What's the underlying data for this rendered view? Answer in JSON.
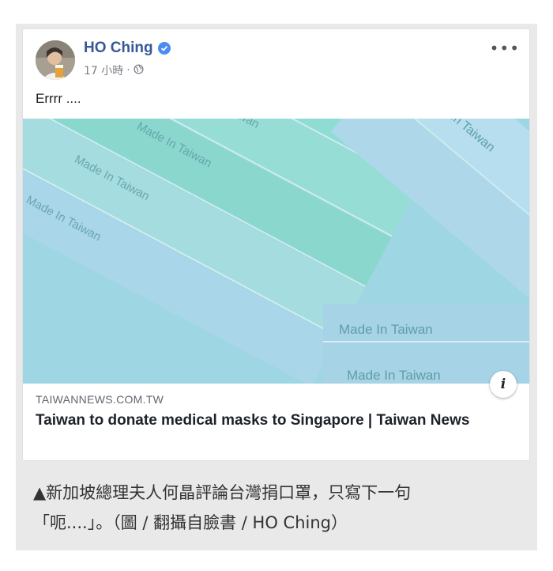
{
  "post": {
    "author": "HO Ching",
    "timestamp": "17 小時",
    "separator": "·",
    "text": "Errrr ...."
  },
  "link": {
    "domain": "TAIWANNEWS.COM.TW",
    "title": "Taiwan to donate medical masks to Singapore | Taiwan News",
    "image_imprint": "Made In Taiwan"
  },
  "caption": {
    "line1": "▲新加坡總理夫人何晶評論台灣捐口罩，只寫下一句",
    "line2": "「呃....」。（圖 / 翻攝自臉書 / HO Ching）"
  },
  "icons": {
    "verified": "verified-badge-icon",
    "privacy": "globe-icon",
    "more": "more-options-icon",
    "info": "info-icon"
  },
  "colors": {
    "author_link": "#385898",
    "verified_blue": "#4a8cf0",
    "frame_gray": "#e9e9e9",
    "mask_teal": "#8fdcd2",
    "mask_blue": "#a9d6e8"
  }
}
